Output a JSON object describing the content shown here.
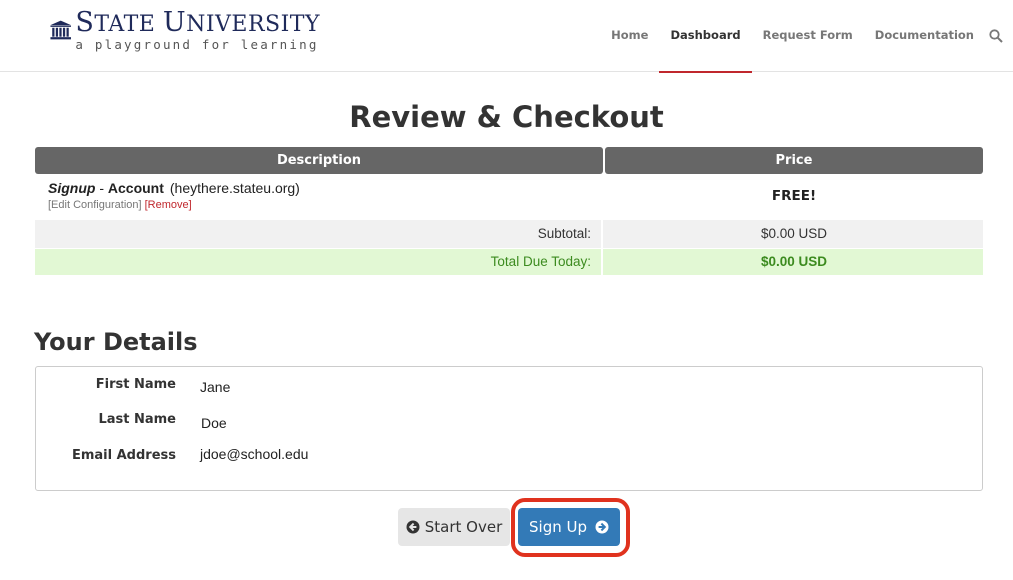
{
  "header": {
    "logo": {
      "title_first_letter": "S",
      "title_rest_1": "TATE ",
      "title_second_letter": "U",
      "title_rest_2": "NIVERSITY",
      "tagline": "a playground for learning"
    },
    "nav": [
      {
        "label": "Home",
        "active": false
      },
      {
        "label": "Dashboard",
        "active": true
      },
      {
        "label": "Request Form",
        "active": false
      },
      {
        "label": "Documentation",
        "active": false
      }
    ],
    "search_icon": "search-icon"
  },
  "page_title": "Review & Checkout",
  "cart": {
    "columns": {
      "description": "Description",
      "price": "Price"
    },
    "item": {
      "group": "Signup",
      "separator": " - ",
      "name": "Account",
      "domain": "(heythere.stateu.org)",
      "edit_label": "[Edit Configuration]",
      "remove_label": "[Remove]",
      "price": "FREE!"
    },
    "subtotal_label": "Subtotal:",
    "subtotal_value": "$0.00 USD",
    "total_label": "Total Due Today:",
    "total_value": "$0.00 USD"
  },
  "details": {
    "title": "Your Details",
    "fields": [
      {
        "label": "First Name",
        "value": "Jane"
      },
      {
        "label": "Last Name",
        "value": "Doe"
      },
      {
        "label": "Email Address",
        "value": "jdoe@school.edu"
      }
    ]
  },
  "buttons": {
    "start_over": "Start Over",
    "sign_up": "Sign Up"
  },
  "colors": {
    "accent_red": "#c0272d",
    "primary_blue": "#337ab7",
    "total_green": "#3c8b1f",
    "highlight": "#e0321e"
  }
}
